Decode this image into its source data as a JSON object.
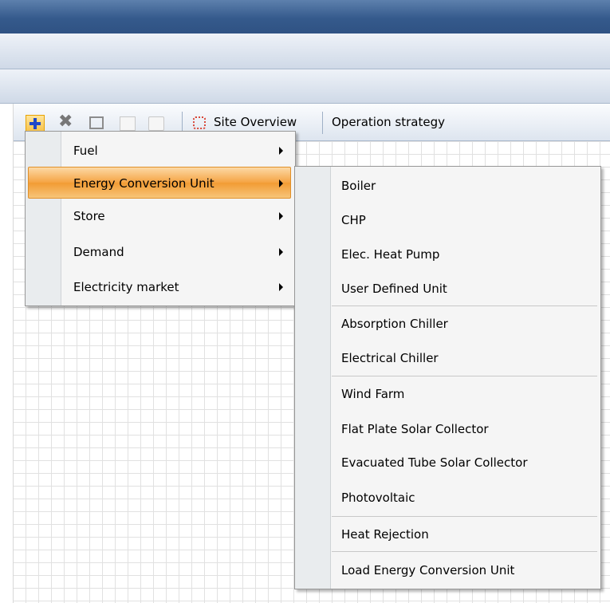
{
  "toolbar": {
    "site_overview_label": "Site Overview",
    "operation_strategy_label": "Operation strategy",
    "icons": [
      "add-icon",
      "delete-icon",
      "save-icon",
      "copy-icon",
      "paste-icon",
      "site-overview-icon"
    ]
  },
  "add_menu": {
    "items": [
      {
        "label": "Fuel",
        "has_submenu": true
      },
      {
        "label": "Energy Conversion Unit",
        "has_submenu": true,
        "active": true
      },
      {
        "label": "Store",
        "has_submenu": true
      },
      {
        "label": "Demand",
        "has_submenu": true
      },
      {
        "label": "Electricity market",
        "has_submenu": true
      }
    ]
  },
  "energy_conversion_submenu": {
    "items": [
      {
        "label": "Boiler"
      },
      {
        "label": "CHP"
      },
      {
        "label": "Elec. Heat Pump"
      },
      {
        "label": "User Defined Unit"
      },
      {
        "label": "Absorption Chiller"
      },
      {
        "label": "Electrical Chiller"
      },
      {
        "label": "Wind Farm"
      },
      {
        "label": "Flat Plate Solar Collector"
      },
      {
        "label": "Evacuated Tube Solar Collector"
      },
      {
        "label": "Photovoltaic"
      },
      {
        "label": "Heat Rejection"
      },
      {
        "label": "Load Energy Conversion Unit"
      }
    ]
  },
  "colors": {
    "titlebar": "#355a8c",
    "menu_highlight": "#f5a342",
    "menu_background": "#f5f5f5"
  }
}
